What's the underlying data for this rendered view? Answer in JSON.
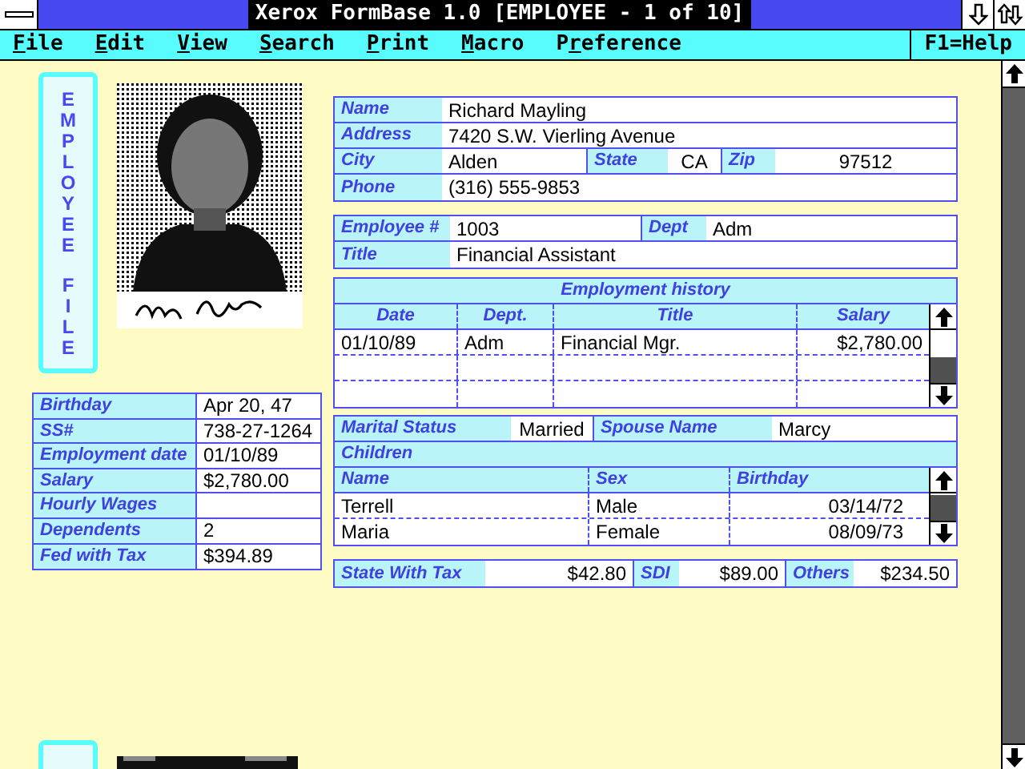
{
  "window": {
    "title": "Xerox FormBase 1.0 [EMPLOYEE - 1 of 10]"
  },
  "menu": [
    {
      "key": "F",
      "after": "ile"
    },
    {
      "key": "E",
      "after": "dit"
    },
    {
      "key": "V",
      "after": "iew"
    },
    {
      "key": "S",
      "after": "earch"
    },
    {
      "key": "P",
      "after": "rint"
    },
    {
      "key": "M",
      "after": "acro"
    },
    {
      "before": "P",
      "key": "r",
      "after": "eference"
    }
  ],
  "help": "F1=Help",
  "banner": {
    "lines": [
      "EMPLOYEE",
      "FILE"
    ]
  },
  "personal": [
    {
      "label": "Birthday",
      "value": "Apr 20, 47"
    },
    {
      "label": "SS#",
      "value": "738-27-1264"
    },
    {
      "label": "Employment date",
      "value": "01/10/89"
    },
    {
      "label": "Salary",
      "value": "$2,780.00"
    },
    {
      "label": "Hourly Wages"
    },
    {
      "label": "Dependents",
      "value": "2"
    },
    {
      "label": "Fed with Tax",
      "value": "$394.89"
    }
  ],
  "address": [
    [
      {
        "label": "Name",
        "value": "Richard Mayling"
      }
    ],
    [
      {
        "label": "Address",
        "value": "7420 S.W. Vierling Avenue"
      }
    ],
    [
      {
        "label": "City",
        "value": "Alden"
      },
      {
        "label": "State",
        "value": "CA"
      },
      {
        "label": "Zip",
        "value": "97512"
      }
    ],
    [
      {
        "label": "Phone",
        "value": "(316) 555-9853"
      }
    ]
  ],
  "employee": [
    [
      {
        "label": "Employee #",
        "value": "1003"
      },
      {
        "label": "Dept",
        "value": "Adm"
      }
    ],
    [
      {
        "label": "Title",
        "value": "Financial Assistant"
      }
    ]
  ],
  "history": {
    "title": "Employment history",
    "columns": [
      "Date",
      "Dept.",
      "Title",
      "Salary"
    ],
    "rows": [
      [
        "01/10/89",
        "Adm",
        "Financial Mgr.",
        "$2,780.00"
      ]
    ]
  },
  "family": {
    "fields": [
      {
        "label": "Marital Status",
        "value": "Married"
      },
      {
        "label": "Spouse Name",
        "value": "Marcy"
      }
    ],
    "children_title": "Children",
    "columns": [
      "Name",
      "Sex",
      "Birthday"
    ],
    "rows": [
      [
        "Terrell",
        "Male",
        "03/14/72"
      ],
      [
        "Maria",
        "Female",
        "08/09/73"
      ]
    ]
  },
  "taxes": [
    {
      "label": "State With Tax",
      "value": "$42.80"
    },
    {
      "label": "SDI",
      "value": "$89.00"
    },
    {
      "label": "Others",
      "value": "$234.50"
    }
  ]
}
